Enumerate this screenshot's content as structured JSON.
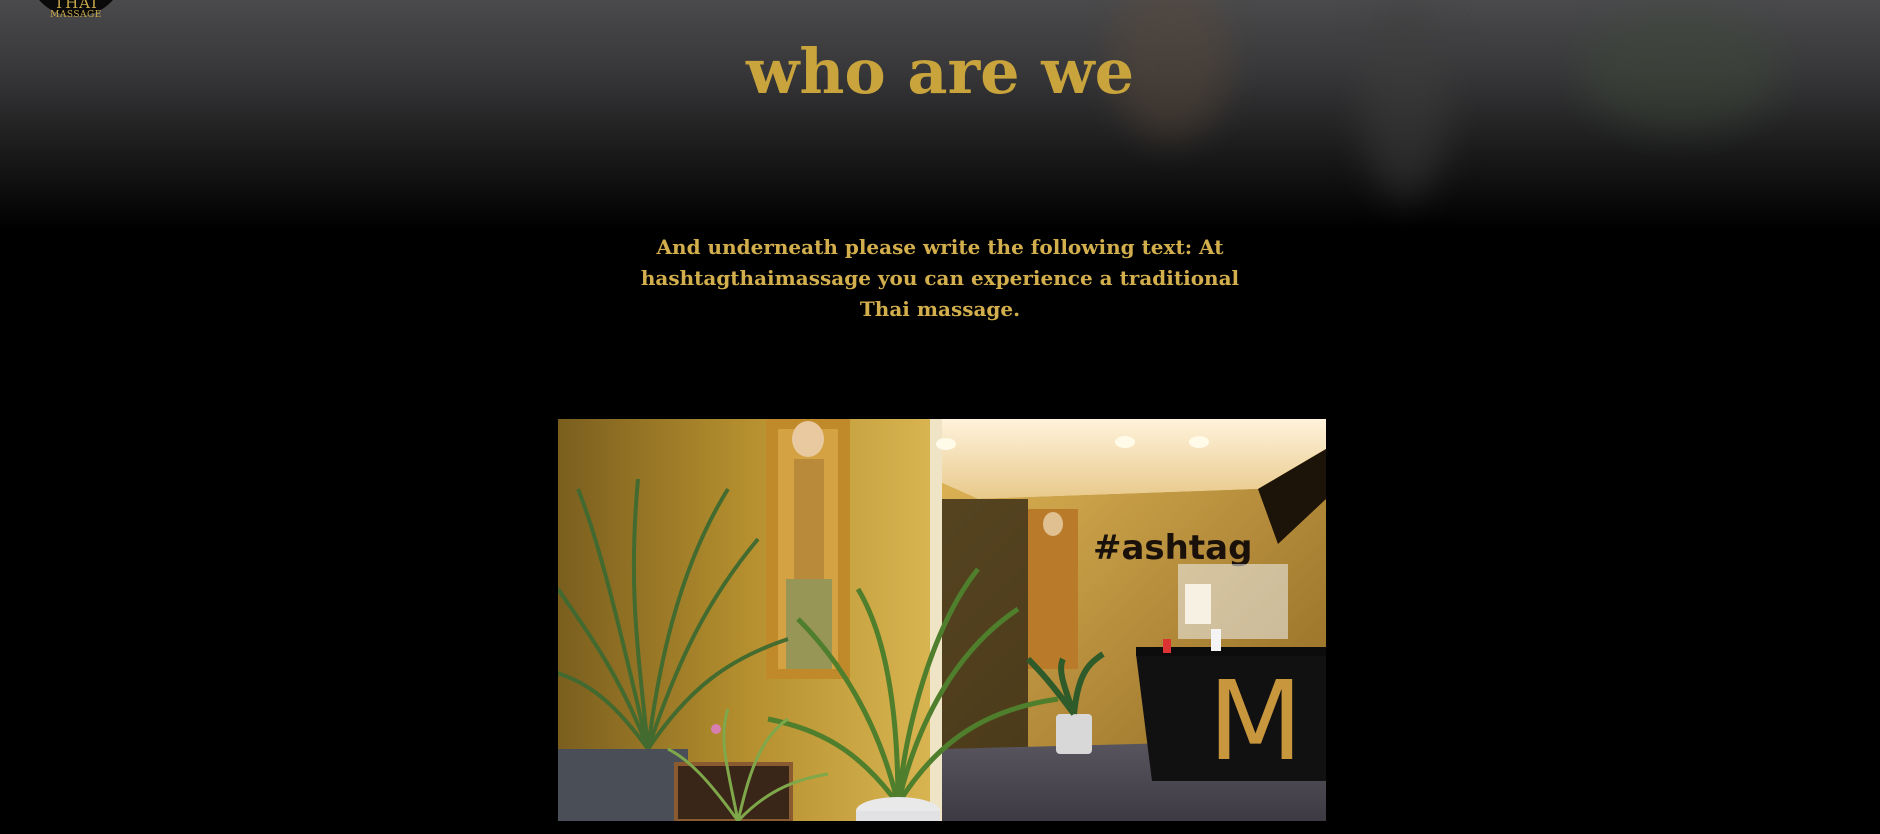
{
  "logo": {
    "line1": "THAI",
    "line2": "MASSAGE"
  },
  "section": {
    "title": "who are we",
    "intro": "And underneath please write the following text: At hashtagthaimassage you can experience a traditional Thai massage."
  },
  "photo": {
    "sign_text": "#ashtag",
    "counter_letter": "M"
  },
  "colors": {
    "gold": "#c9a43c",
    "background": "#000000"
  }
}
